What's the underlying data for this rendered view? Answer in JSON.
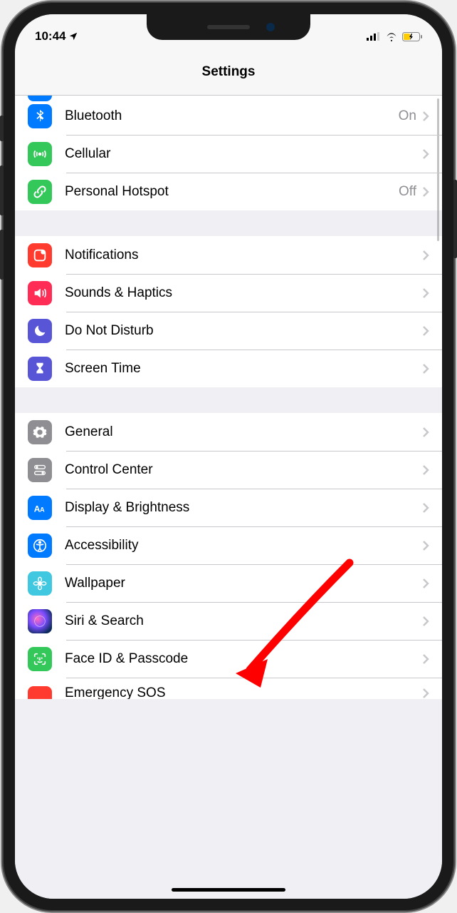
{
  "status": {
    "time": "10:44",
    "location_icon": "location-arrow"
  },
  "nav": {
    "title": "Settings"
  },
  "groups": [
    {
      "id": "connectivity",
      "partial_top": true,
      "items": [
        {
          "id": "bluetooth",
          "label": "Bluetooth",
          "value": "On",
          "icon": "bluetooth-icon",
          "color": "#007aff"
        },
        {
          "id": "cellular",
          "label": "Cellular",
          "value": "",
          "icon": "antenna-icon",
          "color": "#34c759"
        },
        {
          "id": "hotspot",
          "label": "Personal Hotspot",
          "value": "Off",
          "icon": "link-icon",
          "color": "#34c759"
        }
      ]
    },
    {
      "id": "notifications-group",
      "items": [
        {
          "id": "notifications",
          "label": "Notifications",
          "value": "",
          "icon": "notification-icon",
          "color": "#ff3b30"
        },
        {
          "id": "sounds",
          "label": "Sounds & Haptics",
          "value": "",
          "icon": "speaker-icon",
          "color": "#ff2d55"
        },
        {
          "id": "dnd",
          "label": "Do Not Disturb",
          "value": "",
          "icon": "moon-icon",
          "color": "#5856d6"
        },
        {
          "id": "screentime",
          "label": "Screen Time",
          "value": "",
          "icon": "hourglass-icon",
          "color": "#5856d6"
        }
      ]
    },
    {
      "id": "general-group",
      "items": [
        {
          "id": "general",
          "label": "General",
          "value": "",
          "icon": "gear-icon",
          "color": "#8e8e93"
        },
        {
          "id": "controlcenter",
          "label": "Control Center",
          "value": "",
          "icon": "toggles-icon",
          "color": "#8e8e93"
        },
        {
          "id": "display",
          "label": "Display & Brightness",
          "value": "",
          "icon": "text-size-icon",
          "color": "#007aff"
        },
        {
          "id": "accessibility",
          "label": "Accessibility",
          "value": "",
          "icon": "accessibility-icon",
          "color": "#007aff"
        },
        {
          "id": "wallpaper",
          "label": "Wallpaper",
          "value": "",
          "icon": "flower-icon",
          "color": "#40c8e0"
        },
        {
          "id": "siri",
          "label": "Siri & Search",
          "value": "",
          "icon": "siri-icon",
          "color": "#000000"
        },
        {
          "id": "faceid",
          "label": "Face ID & Passcode",
          "value": "",
          "icon": "faceid-icon",
          "color": "#34c759"
        },
        {
          "id": "emergency",
          "label": "Emergency SOS",
          "value": "",
          "icon": "sos-icon",
          "color": "#ff3b30",
          "partial": true
        }
      ]
    }
  ],
  "annotation": {
    "target": "display",
    "arrow_color": "#ff0000"
  }
}
